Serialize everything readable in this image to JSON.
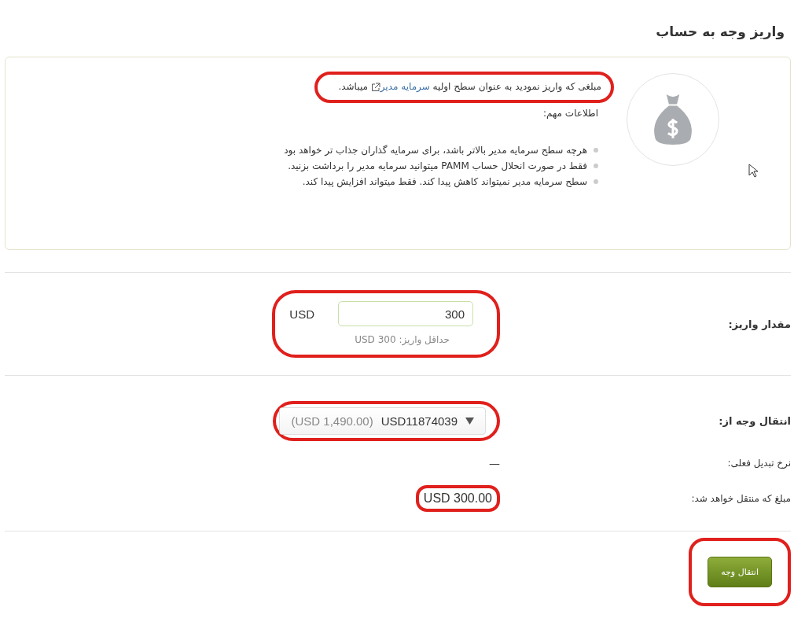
{
  "title": "واریز وجه به حساب",
  "info": {
    "intro_before": "مبلغی که واریز نمودید به عنوان سطح اولیه",
    "intro_link": "سرمایه مدیر",
    "intro_after": "میباشد.",
    "highlighted": true,
    "heading": "اطلاعات مهم:",
    "bullets": [
      "هرچه سطح سرمایه مدیر بالاتر باشد، برای سرمایه گذاران جذاب تر خواهد بود",
      "فقط در صورت انحلال حساب PAMM میتوانید سرمایه مدیر را برداشت بزنید.",
      "سطح سرمایه مدیر نمیتواند کاهش پیدا کند. فقط میتواند افزایش پیدا کند."
    ]
  },
  "deposit": {
    "label": "مقدار واریز:",
    "currency": "USD",
    "value": "300",
    "hint": "حداقل واریز: USD 300",
    "highlighted": true
  },
  "transfer": {
    "label": "انتقال وجه از:",
    "account": "USD11874039",
    "balance": "(USD 1,490.00)",
    "highlighted": true
  },
  "rate": {
    "label": "نرخ تبدیل فعلی:",
    "value": "—"
  },
  "amount": {
    "label": "مبلغ که منتقل خواهد شد:",
    "value": "USD 300.00",
    "highlighted": true
  },
  "submit": {
    "label": "انتقال وجه",
    "highlighted": true
  }
}
